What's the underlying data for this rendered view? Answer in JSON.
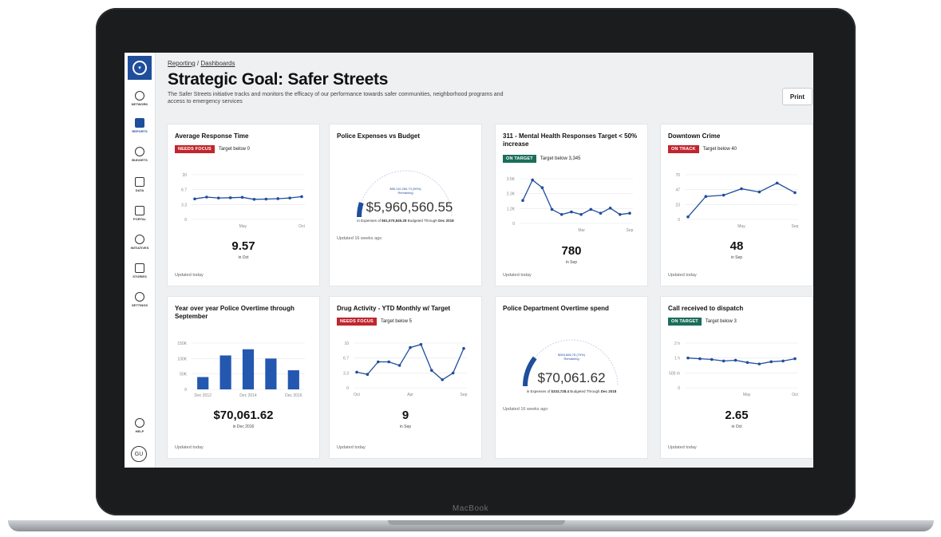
{
  "device": {
    "brand": "MacBook"
  },
  "sidebar": {
    "items": [
      {
        "label": "NETWORK",
        "icon": "globe-icon"
      },
      {
        "label": "REPORTS",
        "icon": "reports-icon",
        "active": true
      },
      {
        "label": "BUDGETS",
        "icon": "dollar-icon"
      },
      {
        "label": "DATA",
        "icon": "data-icon"
      },
      {
        "label": "PORTAL",
        "icon": "portal-icon"
      },
      {
        "label": "INITIATIVES",
        "icon": "target-icon"
      },
      {
        "label": "STORIES",
        "icon": "stories-icon"
      },
      {
        "label": "SETTINGS",
        "icon": "gear-icon"
      }
    ],
    "help_label": "HELP",
    "avatar_initials": "GU"
  },
  "header": {
    "breadcrumb_root": "Reporting",
    "breadcrumb_sep": " / ",
    "breadcrumb_current": "Dashboards",
    "title": "Strategic Goal: Safer Streets",
    "description": "The Safer Streets initiative tracks and monitors the efficacy of our performance towards safer communities, neighborhood programs and access to emergency services",
    "print_label": "Print"
  },
  "colors": {
    "brand": "#1f4e9c",
    "needs_focus": "#c0262d",
    "on_target": "#1a6e5a"
  },
  "cards": {
    "response_time": {
      "title": "Average Response Time",
      "badge": "NEEDS FOCUS",
      "target": "Target below 0",
      "value": "9.57",
      "period": "in Oct",
      "updated": "Updated today",
      "chart_data": {
        "type": "line",
        "x": [
          "",
          "",
          "",
          "",
          "May",
          "",
          "",
          "",
          "",
          "Oct"
        ],
        "y": [
          9.2,
          10.0,
          9.6,
          9.7,
          9.9,
          9.0,
          9.1,
          9.3,
          9.6,
          10.2
        ],
        "yticks": [
          "20",
          "6.7",
          "3.3",
          "0"
        ],
        "xticks": [
          "May",
          "Oct"
        ]
      }
    },
    "police_expenses": {
      "title": "Police Expenses vs Budget",
      "remaining": "$55,110,284.73 (90%)",
      "remaining_label": "Remaining",
      "value": "$5,960,560.55",
      "caption_prefix": "in Expenses of ",
      "caption_budget": "$61,070,845.28",
      "caption_mid": " Budgeted Through ",
      "caption_date": "Dec 2018",
      "updated": "Updated 16 weeks ago",
      "fraction_spent": 0.1
    },
    "mental_health": {
      "title": "311 - Mental Health Responses Target < 50% increase",
      "badge": "ON TARGET",
      "target": "Target below 3,345",
      "value": "780",
      "period": "in Sep",
      "updated": "Updated today",
      "chart_data": {
        "type": "line",
        "y": [
          1800,
          3400,
          2800,
          1100,
          700,
          900,
          700,
          1100,
          800,
          1200,
          700,
          800
        ],
        "yticks": [
          "3.5K",
          "2.3K",
          "1.2K",
          "0"
        ],
        "xticks": [
          "Mar",
          "Sep"
        ]
      }
    },
    "downtown_crime": {
      "title": "Downtown Crime",
      "badge": "ON TRACK",
      "target": "Target below 40",
      "value": "48",
      "period": "in Sep",
      "updated": "Updated today",
      "chart_data": {
        "type": "line",
        "y": [
          4,
          36,
          38,
          48,
          43,
          57,
          42
        ],
        "yticks": [
          "70",
          "47",
          "23",
          "0"
        ],
        "xticks": [
          "May",
          "Sep"
        ]
      }
    },
    "overtime_yoy": {
      "title": "Year over year Police Overtime through September",
      "value": "$70,061.62",
      "period": "in Dec 2016",
      "updated": "Updated today",
      "chart_data": {
        "type": "bar",
        "categories": [
          "Dec 2012",
          "",
          "Dec 2014",
          "",
          "Dec 2016"
        ],
        "values": [
          40000,
          110000,
          130000,
          100000,
          62000
        ],
        "yticks": [
          "150K",
          "100K",
          "50K",
          "0"
        ],
        "xticks": [
          "Dec 2012",
          "Dec 2014",
          "Dec 2016"
        ]
      }
    },
    "drug_activity": {
      "title": "Drug Activity - YTD Monthly w/ Target",
      "badge": "NEEDS FOCUS",
      "target": "Target below 5",
      "value": "9",
      "period": "in Sep",
      "updated": "Updated today",
      "chart_data": {
        "type": "line",
        "y": [
          3.5,
          3.0,
          5.8,
          5.8,
          5.0,
          9.0,
          9.7,
          3.9,
          1.8,
          3.3,
          8.8
        ],
        "yticks": [
          "10",
          "6.7",
          "3.3",
          "0"
        ],
        "xticks": [
          "Oct",
          "Apr",
          "Sep"
        ]
      }
    },
    "overtime_spend": {
      "title": "Police Department Overtime spend",
      "remaining": "$263,666.78 (79%)",
      "remaining_label": "Remaining",
      "value": "$70,061.62",
      "caption_prefix": "in Expenses of ",
      "caption_budget": "$333,728.4",
      "caption_mid": " Budgeted Through ",
      "caption_date": "Dec 2018",
      "updated": "Updated 16 weeks ago",
      "fraction_spent": 0.21
    },
    "dispatch": {
      "title": "Call received to dispatch",
      "badge": "ON TARGET",
      "target": "Target below 3",
      "value": "2.65",
      "period": "in Oct",
      "updated": "Updated today",
      "chart_data": {
        "type": "line",
        "y": [
          2.0,
          1.95,
          1.9,
          1.8,
          1.85,
          1.7,
          1.6,
          1.75,
          1.8,
          1.95
        ],
        "yticks": [
          "2 h",
          "1 h",
          "500 m",
          "0"
        ],
        "xticks": [
          "May",
          "Oct"
        ]
      }
    }
  }
}
